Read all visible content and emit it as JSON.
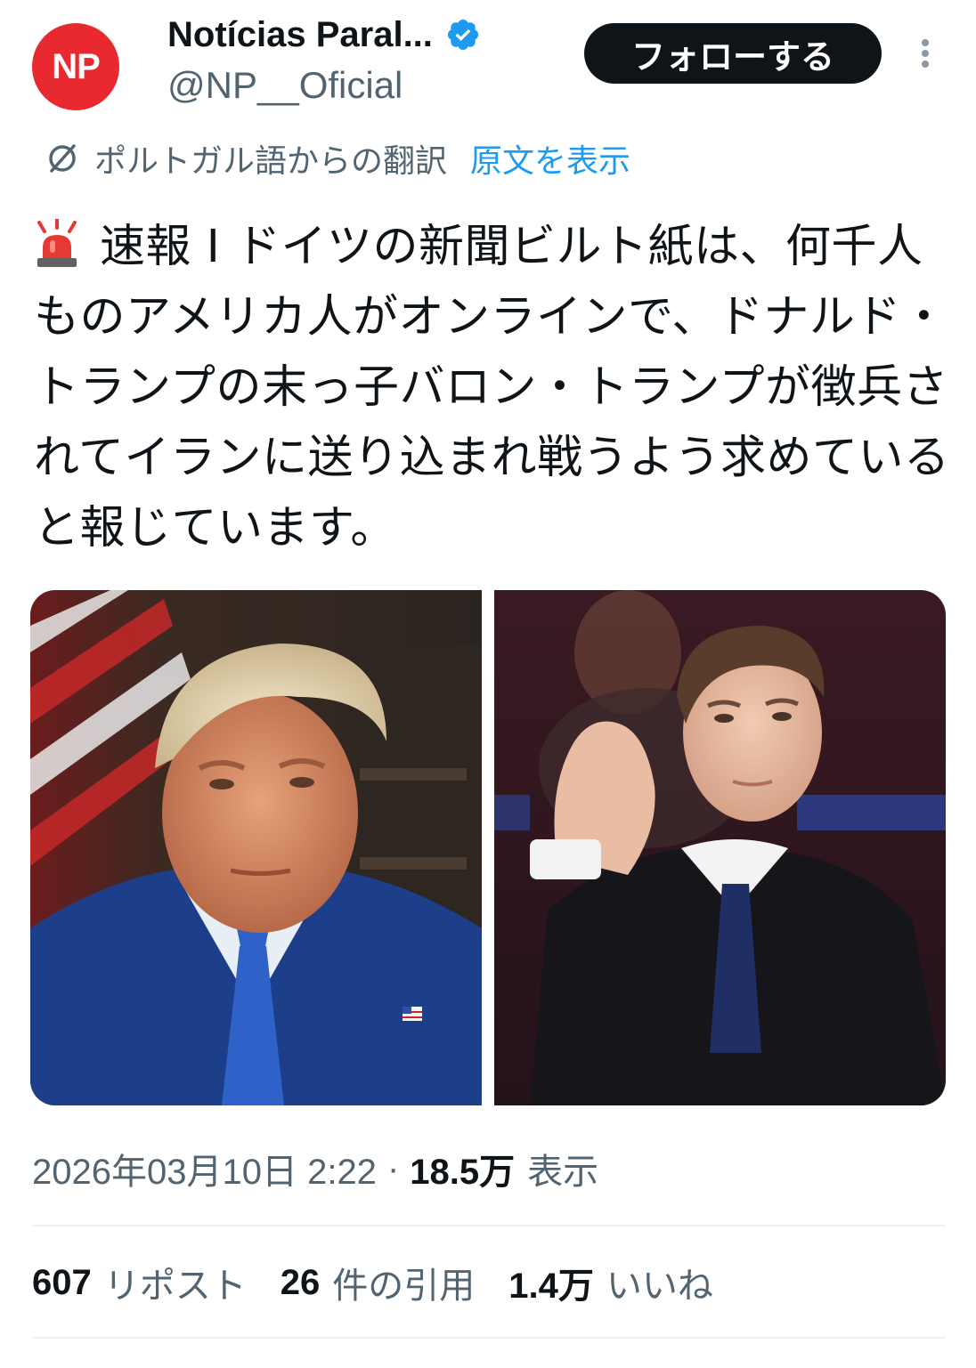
{
  "header": {
    "avatar_text": "NP",
    "display_name": "Notícias Paral...",
    "handle": "@NP__Oficial",
    "follow_label": "フォローする"
  },
  "translation": {
    "label": "ポルトガル語からの翻訳",
    "show_original": "原文を表示"
  },
  "tweet": {
    "text": "速報 I ドイツの新聞ビルト紙は、何千人ものアメリカ人がオンラインで、ドナルド・トランプの末っ子バロン・トランプが徴兵されてイランに送り込まれ戦うよう求めていると報じています。"
  },
  "meta": {
    "datetime": "2026年03月10日 2:22",
    "separator": "·",
    "views_count": "18.5万",
    "views_label": "表示"
  },
  "stats": [
    {
      "count": "607",
      "label": "リポスト"
    },
    {
      "count": "26",
      "label": "件の引用"
    },
    {
      "count": "1.4万",
      "label": "いいね"
    }
  ],
  "colors": {
    "brand_red": "#e8292f",
    "verified_blue": "#1d9bf0",
    "link_blue": "#1d9bf0",
    "follow_button": "#0f1419",
    "secondary_text": "#536471"
  },
  "icons": {
    "verified": "verified-badge-icon",
    "translate": "translate-icon",
    "siren": "siren-emoji-icon",
    "more": "more-options-icon"
  }
}
